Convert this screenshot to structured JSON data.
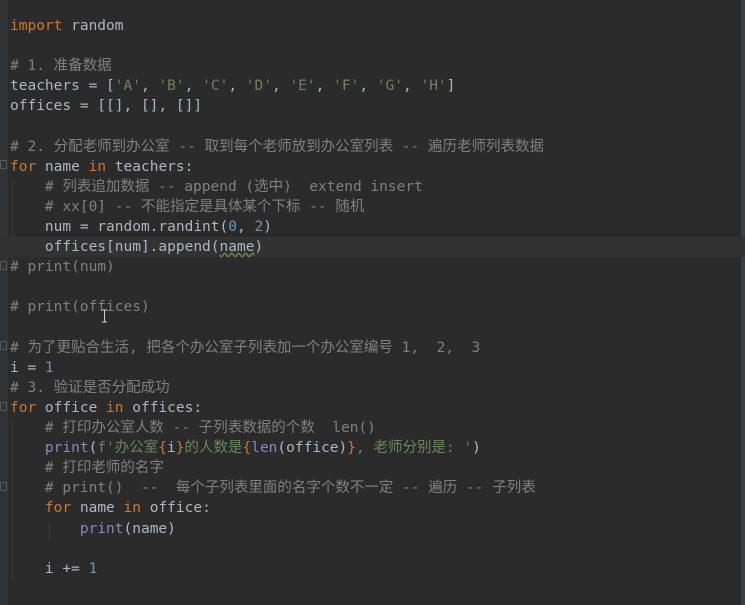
{
  "editor": {
    "language": "python",
    "theme": {
      "background": "#2b2b2b",
      "keyword": "#cc7832",
      "string": "#6a8759",
      "number": "#6897bb",
      "comment": "#808080",
      "builtin": "#8888c6",
      "text": "#a9b7c6"
    },
    "lines": [
      [
        [
          "kw",
          "import"
        ],
        [
          "t",
          " random"
        ]
      ],
      [],
      [
        [
          "cmt",
          "# 1. 准备数据"
        ]
      ],
      [
        [
          "t",
          "teachers = ["
        ],
        [
          "str",
          "'A'"
        ],
        [
          "t",
          ", "
        ],
        [
          "str",
          "'B'"
        ],
        [
          "t",
          ", "
        ],
        [
          "str",
          "'C'"
        ],
        [
          "t",
          ", "
        ],
        [
          "str",
          "'D'"
        ],
        [
          "t",
          ", "
        ],
        [
          "str",
          "'E'"
        ],
        [
          "t",
          ", "
        ],
        [
          "str",
          "'F'"
        ],
        [
          "t",
          ", "
        ],
        [
          "str",
          "'G'"
        ],
        [
          "t",
          ", "
        ],
        [
          "str",
          "'H'"
        ],
        [
          "t",
          "]"
        ]
      ],
      [
        [
          "t",
          "offices = [[], [], []]"
        ]
      ],
      [],
      [
        [
          "cmt",
          "# 2. 分配老师到办公室 -- 取到每个老师放到办公室列表 -- 遍历老师列表数据"
        ]
      ],
      [
        [
          "kw",
          "for"
        ],
        [
          "t",
          " name "
        ],
        [
          "kw",
          "in"
        ],
        [
          "t",
          " teachers:"
        ]
      ],
      [
        [
          "t",
          "    "
        ],
        [
          "cmt",
          "# 列表追加数据 -- append (选中)  extend insert"
        ]
      ],
      [
        [
          "t",
          "    "
        ],
        [
          "cmt",
          "# xx[0] -- 不能指定是具体某个下标 -- 随机"
        ]
      ],
      [
        [
          "t",
          "    num = random.randint("
        ],
        [
          "num",
          "0"
        ],
        [
          "t",
          ", "
        ],
        [
          "num",
          "2"
        ],
        [
          "t",
          ")"
        ]
      ],
      [
        [
          "t",
          "    offices[num].append("
        ],
        [
          "typo",
          "name"
        ],
        [
          "t",
          ")"
        ]
      ],
      [
        [
          "cmt",
          "# print(num)"
        ]
      ],
      [],
      [
        [
          "cmt",
          "# print(offices)"
        ]
      ],
      [],
      [
        [
          "cmt",
          "# 为了更贴合生活, 把各个办公室子列表加一个办公室编号 1,  2,  3"
        ]
      ],
      [
        [
          "t",
          "i = "
        ],
        [
          "num",
          "1"
        ]
      ],
      [
        [
          "cmt",
          "# 3. 验证是否分配成功"
        ]
      ],
      [
        [
          "kw",
          "for"
        ],
        [
          "t",
          " office "
        ],
        [
          "kw",
          "in"
        ],
        [
          "t",
          " offices:"
        ]
      ],
      [
        [
          "t",
          "    "
        ],
        [
          "cmt",
          "# 打印办公室人数 -- 子列表数据的个数  len()"
        ]
      ],
      [
        [
          "t",
          "    "
        ],
        [
          "fn",
          "print"
        ],
        [
          "t",
          "("
        ],
        [
          "str",
          "f'办公室"
        ],
        [
          "fmt",
          "{"
        ],
        [
          "t",
          "i"
        ],
        [
          "fmt",
          "}"
        ],
        [
          "str",
          "的人数是"
        ],
        [
          "fmt",
          "{"
        ],
        [
          "fn",
          "len"
        ],
        [
          "t",
          "(office)"
        ],
        [
          "fmt",
          "}"
        ],
        [
          "str",
          ", 老师分别是: '"
        ],
        [
          "t",
          ")"
        ]
      ],
      [
        [
          "t",
          "    "
        ],
        [
          "cmt",
          "# 打印老师的名字"
        ]
      ],
      [
        [
          "t",
          "    "
        ],
        [
          "cmt",
          "# print()  --  每个子列表里面的名字个数不一定 -- 遍历 -- 子列表"
        ]
      ],
      [
        [
          "t",
          "    "
        ],
        [
          "kw",
          "for"
        ],
        [
          "t",
          " name "
        ],
        [
          "kw",
          "in"
        ],
        [
          "t",
          " office:"
        ]
      ],
      [
        [
          "t",
          "        "
        ],
        [
          "fn",
          "print"
        ],
        [
          "t",
          "(name)"
        ]
      ],
      [],
      [
        [
          "t",
          "    i += "
        ],
        [
          "num",
          "1"
        ]
      ]
    ]
  }
}
